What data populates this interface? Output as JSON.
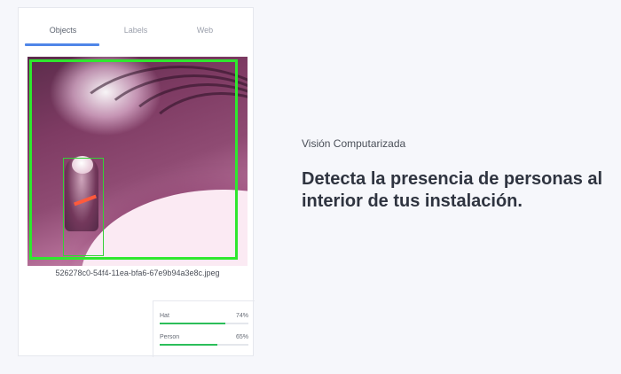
{
  "tabs": [
    {
      "label": "Objects",
      "active": true
    },
    {
      "label": "Labels",
      "active": false
    },
    {
      "label": "Web",
      "active": false
    }
  ],
  "image": {
    "filename": "526278c0-54f4-11ea-bfa6-67e9b94a3e8c.jpeg"
  },
  "confidences": [
    {
      "label": "Hat",
      "percent_text": "74%",
      "value": 0.74
    },
    {
      "label": "Person",
      "percent_text": "65%",
      "value": 0.65
    }
  ],
  "hero": {
    "subtitle": "Visión Computarizada",
    "headline": "Detecta la presencia de personas al interior de tus instalación."
  },
  "colors": {
    "tab_underline": "#4f86e8",
    "detection_box": "#2ee82e",
    "confidence_bar": "#2cbe5a"
  }
}
